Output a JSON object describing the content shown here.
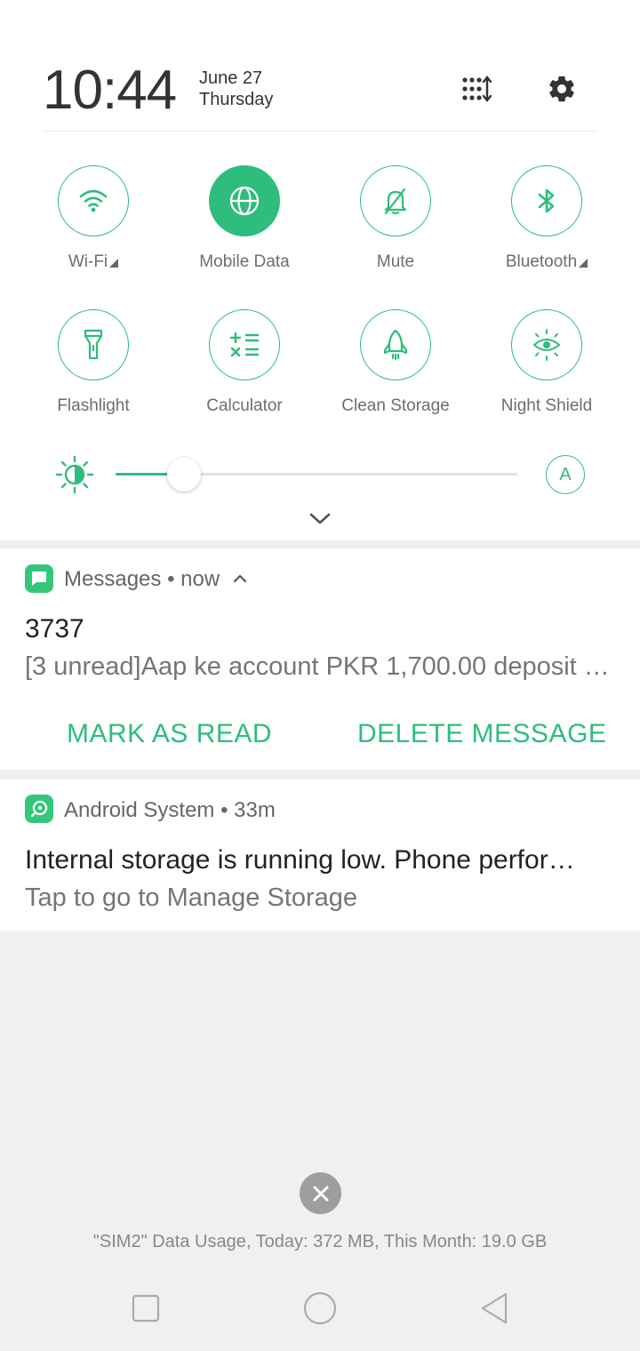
{
  "header": {
    "time": "10:44",
    "date": "June 27",
    "weekday": "Thursday",
    "edit_icon": "edit-tiles-icon",
    "settings_icon": "gear-icon"
  },
  "tiles": [
    {
      "label": "Wi-Fi",
      "icon": "wifi-icon",
      "active": false,
      "expandable": true
    },
    {
      "label": "Mobile Data",
      "icon": "globe-icon",
      "active": true,
      "expandable": false
    },
    {
      "label": "Mute",
      "icon": "bell-off-icon",
      "active": false,
      "expandable": false
    },
    {
      "label": "Bluetooth",
      "icon": "bluetooth-icon",
      "active": false,
      "expandable": true
    },
    {
      "label": "Flashlight",
      "icon": "flashlight-icon",
      "active": false,
      "expandable": false
    },
    {
      "label": "Calculator",
      "icon": "calculator-icon",
      "active": false,
      "expandable": false
    },
    {
      "label": "Clean Storage",
      "icon": "rocket-icon",
      "active": false,
      "expandable": false
    },
    {
      "label": "Night Shield",
      "icon": "eye-icon",
      "active": false,
      "expandable": false
    }
  ],
  "brightness": {
    "level": 0.17,
    "auto_label": "A"
  },
  "notifications": {
    "messages": {
      "app": "Messages",
      "time": "now",
      "title": "3737",
      "body": "[3 unread]Aap ke account PKR 1,700.00 deposit …",
      "actions": [
        "MARK AS READ",
        "DELETE MESSAGE"
      ]
    },
    "system": {
      "app": "Android System",
      "time": "33m",
      "title": "Internal storage is running low. Phone perfor…",
      "body": "Tap to go to Manage Storage"
    }
  },
  "footer": {
    "data_usage": "\"SIM2\" Data Usage, Today: 372 MB, This Month: 19.0 GB"
  },
  "colors": {
    "accent": "#2ebd7c",
    "panel_bg": "#ffffff",
    "shade_bg": "#f0f0f0"
  }
}
